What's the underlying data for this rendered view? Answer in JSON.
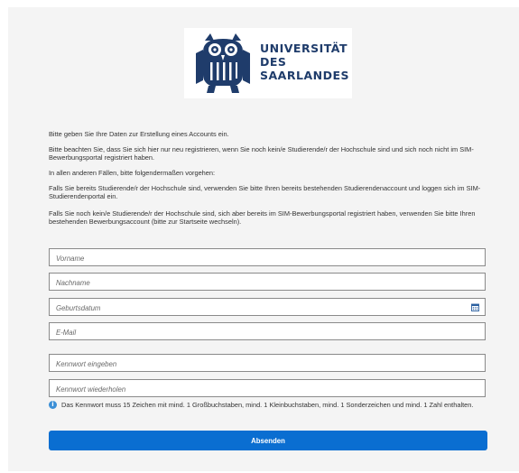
{
  "logo": {
    "line1": "UNIVERSITÄT",
    "line2": "DES",
    "line3": "SAARLANDES",
    "brand_color": "#1f3c6b"
  },
  "intro": [
    "Bitte geben Sie Ihre Daten zur Erstellung eines Accounts ein.",
    "Bitte beachten Sie, dass Sie sich hier nur neu registrieren, wenn Sie noch kein/e Studierende/r der Hochschule sind und sich noch nicht im SIM-Bewerbungsportal registriert haben.",
    "In allen anderen Fällen, bitte folgendermaßen vorgehen:",
    "Falls Sie bereits Studierende/r der Hochschule sind, verwenden Sie bitte Ihren bereits bestehenden Studierendenaccount und loggen sich im SIM-Studierendenportal ein.",
    "Falls Sie noch kein/e Studierende/r der Hochschule sind, sich aber bereits im SIM-Bewerbungsportal registriert haben, verwenden Sie bitte Ihren bestehenden Bewerbungsaccount (bitte zur Startseite wechseln)."
  ],
  "fields": {
    "vorname": "Vorname",
    "nachname": "Nachname",
    "geburtsdatum": "Geburtsdatum",
    "email": "E-Mail",
    "kennwort": "Kennwort eingeben",
    "kennwort_wdh": "Kennwort wiederholen"
  },
  "hint": {
    "icon": "info-icon",
    "text": "Das Kennwort muss 15 Zeichen mit mind. 1 Großbuchstaben, mind. 1 Kleinbuchstaben, mind. 1 Sonderzeichen und mind. 1 Zahl enthalten."
  },
  "submit_label": "Absenden",
  "colors": {
    "accent": "#0a6ed1",
    "info": "#3b8fd6"
  }
}
